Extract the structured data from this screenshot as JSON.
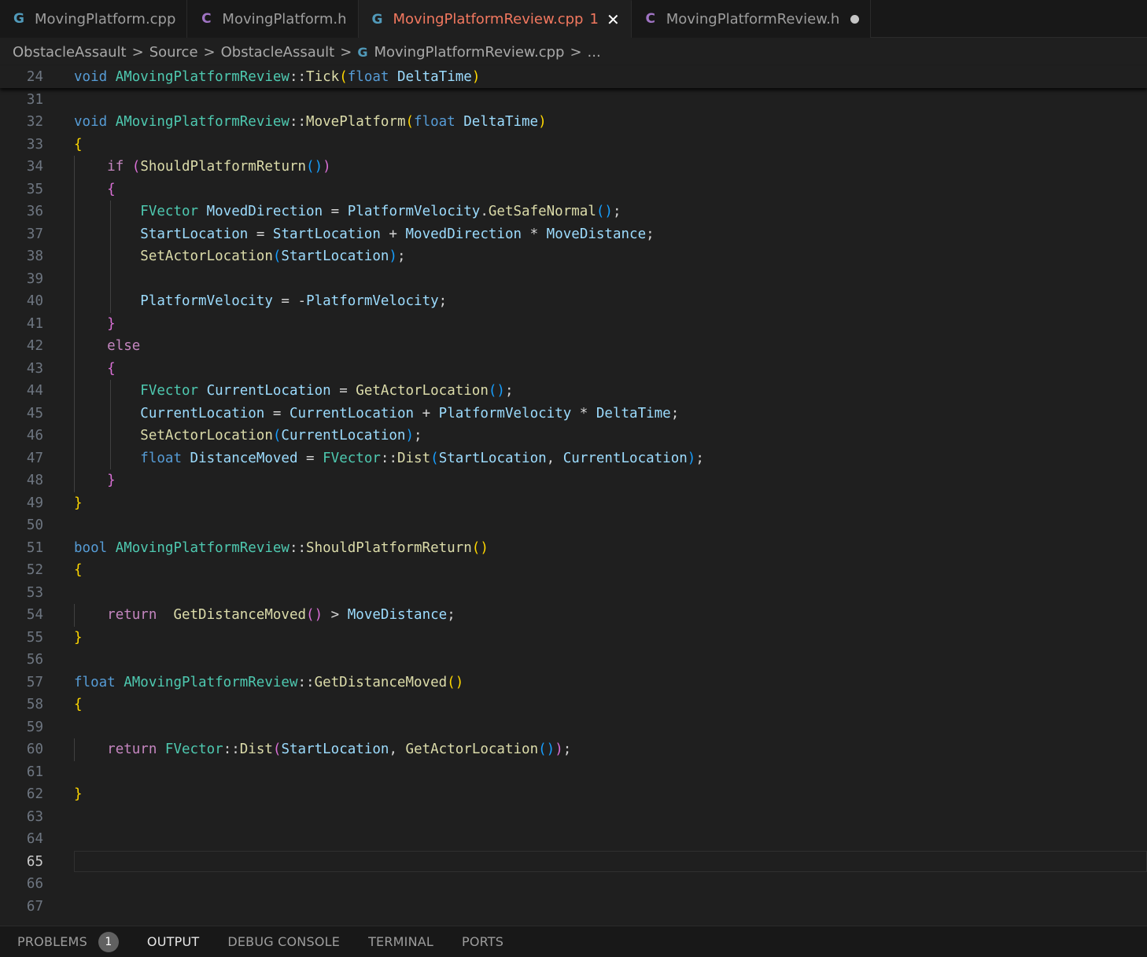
{
  "tabs": [
    {
      "label": "MovingPlatform.cpp",
      "icon": "cpp-file-icon"
    },
    {
      "label": "MovingPlatform.h",
      "icon": "header-file-icon"
    },
    {
      "label": "MovingPlatformReview.cpp",
      "icon": "cpp-file-icon",
      "active": true,
      "badge": "1"
    },
    {
      "label": "MovingPlatformReview.h",
      "icon": "header-file-icon",
      "modified": true
    }
  ],
  "breadcrumb": {
    "items": [
      "ObstacleAssault",
      "Source",
      "ObstacleAssault",
      "MovingPlatformReview.cpp",
      "..."
    ]
  },
  "editor": {
    "current_line": "65",
    "lines": [
      {
        "n": "24",
        "text": "void AMovingPlatformReview::Tick(float DeltaTime)"
      },
      {
        "n": "31",
        "text": ""
      },
      {
        "n": "32",
        "text": "void AMovingPlatformReview::MovePlatform(float DeltaTime)"
      },
      {
        "n": "33",
        "text": "{"
      },
      {
        "n": "34",
        "text": "    if (ShouldPlatformReturn())"
      },
      {
        "n": "35",
        "text": "    {"
      },
      {
        "n": "36",
        "text": "        FVector MovedDirection = PlatformVelocity.GetSafeNormal();"
      },
      {
        "n": "37",
        "text": "        StartLocation = StartLocation + MovedDirection * MoveDistance;"
      },
      {
        "n": "38",
        "text": "        SetActorLocation(StartLocation);"
      },
      {
        "n": "39",
        "text": ""
      },
      {
        "n": "40",
        "text": "        PlatformVelocity = -PlatformVelocity;"
      },
      {
        "n": "41",
        "text": "    }"
      },
      {
        "n": "42",
        "text": "    else"
      },
      {
        "n": "43",
        "text": "    {"
      },
      {
        "n": "44",
        "text": "        FVector CurrentLocation = GetActorLocation();"
      },
      {
        "n": "45",
        "text": "        CurrentLocation = CurrentLocation + PlatformVelocity * DeltaTime;"
      },
      {
        "n": "46",
        "text": "        SetActorLocation(CurrentLocation);"
      },
      {
        "n": "47",
        "text": "        float DistanceMoved = FVector::Dist(StartLocation, CurrentLocation);"
      },
      {
        "n": "48",
        "text": "    }"
      },
      {
        "n": "49",
        "text": "}"
      },
      {
        "n": "50",
        "text": ""
      },
      {
        "n": "51",
        "text": "bool AMovingPlatformReview::ShouldPlatformReturn()"
      },
      {
        "n": "52",
        "text": "{"
      },
      {
        "n": "53",
        "text": ""
      },
      {
        "n": "54",
        "text": "    return  GetDistanceMoved() > MoveDistance;"
      },
      {
        "n": "55",
        "text": "}"
      },
      {
        "n": "56",
        "text": ""
      },
      {
        "n": "57",
        "text": "float AMovingPlatformReview::GetDistanceMoved()"
      },
      {
        "n": "58",
        "text": "{"
      },
      {
        "n": "59",
        "text": ""
      },
      {
        "n": "60",
        "text": "    return FVector::Dist(StartLocation, GetActorLocation());"
      },
      {
        "n": "61",
        "text": ""
      },
      {
        "n": "62",
        "text": "}"
      },
      {
        "n": "63",
        "text": ""
      },
      {
        "n": "64",
        "text": ""
      },
      {
        "n": "65",
        "text": ""
      },
      {
        "n": "66",
        "text": ""
      },
      {
        "n": "67",
        "text": ""
      }
    ]
  },
  "panel": {
    "tabs": [
      {
        "label": "PROBLEMS",
        "badge": "1"
      },
      {
        "label": "OUTPUT",
        "active": true
      },
      {
        "label": "DEBUG CONSOLE"
      },
      {
        "label": "TERMINAL"
      },
      {
        "label": "PORTS"
      }
    ]
  },
  "colors": {
    "background": "#1f1f1f",
    "tabbar": "#181818",
    "active_tab_text": "#f2785f",
    "keyword": "#569cd6",
    "control_keyword": "#c586c0",
    "type": "#4ec9b0",
    "function": "#dcdcaa",
    "variable": "#9cdcfe",
    "line_number": "#6e7681"
  }
}
